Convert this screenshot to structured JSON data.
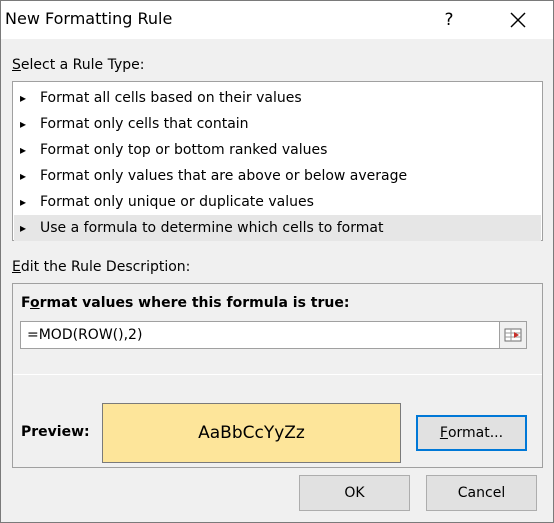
{
  "dialog": {
    "title": "New Formatting Rule",
    "help_label": "?",
    "close_icon": "close-icon"
  },
  "rule_type": {
    "label_first": "S",
    "label_rest": "elect a Rule Type:",
    "items": [
      {
        "label": "Format all cells based on their values",
        "selected": false
      },
      {
        "label": "Format only cells that contain",
        "selected": false
      },
      {
        "label": "Format only top or bottom ranked values",
        "selected": false
      },
      {
        "label": "Format only values that are above or below average",
        "selected": false
      },
      {
        "label": "Format only unique or duplicate values",
        "selected": false
      },
      {
        "label": "Use a formula to determine which cells to format",
        "selected": true
      }
    ],
    "item_icon": "arrow-right-icon"
  },
  "description": {
    "label_first": "E",
    "label_rest": "dit the Rule Description:",
    "formula_label_a": "F",
    "formula_label_b": "o",
    "formula_label_c": "rmat values where this formula is true:",
    "formula_value": "=MOD(ROW(),2)",
    "preview_label": "Preview:",
    "preview_text": "AaBbCcYyZz",
    "preview_fill": "#fde59a",
    "format_button_first": "F",
    "format_button_rest": "ormat..."
  },
  "buttons": {
    "ok": "OK",
    "cancel": "Cancel"
  },
  "colors": {
    "accent": "#0078d7",
    "selected_row": "#e6e6e6"
  }
}
